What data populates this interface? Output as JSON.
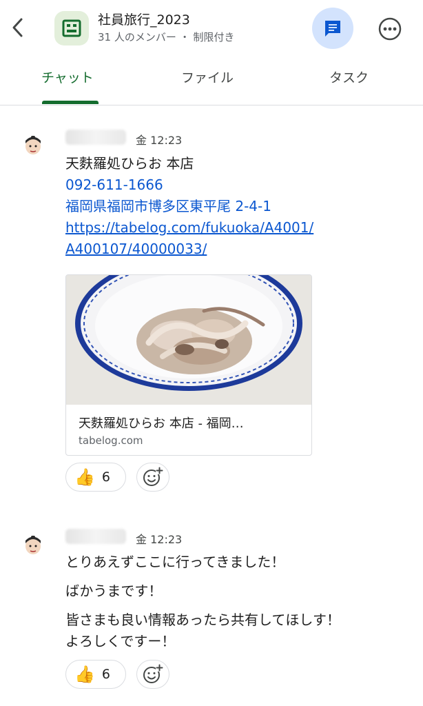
{
  "header": {
    "title": "社員旅行_2023",
    "subtitle": "31 人のメンバー ・ 制限付き",
    "icons": {
      "back": "chevron-left-icon",
      "space": "space-icon",
      "thread": "thread-icon",
      "more": "more-vert-icon"
    },
    "colors": {
      "accent_green": "#146c2e",
      "thread_bg": "#d3e3fd",
      "thread_icon": "#0b57d0"
    }
  },
  "tabs": [
    {
      "label": "チャット",
      "active": true
    },
    {
      "label": "ファイル",
      "active": false
    },
    {
      "label": "タスク",
      "active": false
    }
  ],
  "messages": [
    {
      "time": "金 12:23",
      "lines": [
        "天麩羅処ひらお 本店",
        "092-611-1666",
        "福岡県福岡市博多区東平尾 2-4-1",
        "https://tabelog.com/fukuoka/A4001/",
        "A400107/40000033/"
      ],
      "preview": {
        "title": "天麩羅処ひらお 本店 - 福岡…",
        "domain": "tabelog.com"
      },
      "reaction": {
        "emoji": "👍",
        "count": "6"
      }
    },
    {
      "time": "金 12:23",
      "lines": [
        "とりあえずここに行ってきました！",
        "ばかうまです！",
        "皆さまも良い情報あったら共有してほしす！",
        "よろしくですー！"
      ],
      "reaction": {
        "emoji": "👍",
        "count": "6"
      }
    }
  ]
}
